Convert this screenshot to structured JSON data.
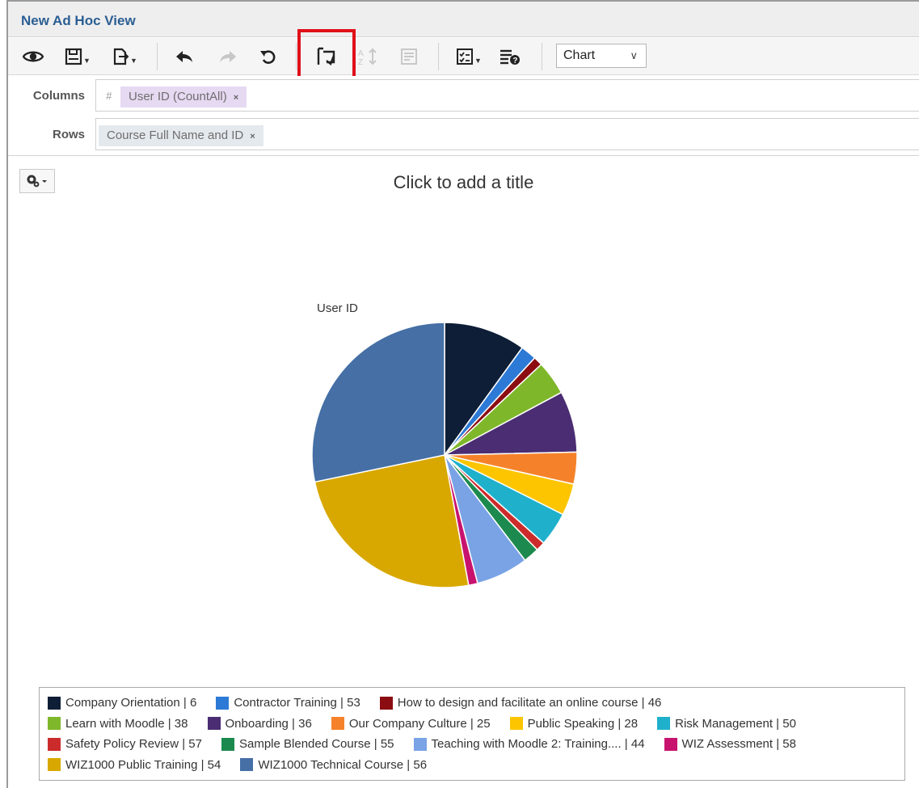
{
  "app": {
    "title": "New Ad Hoc View"
  },
  "toolbar": {
    "view_type": "Chart",
    "buttons": [
      {
        "name": "display-mode-button",
        "icon": "eye-icon"
      },
      {
        "name": "save-button",
        "icon": "save-icon"
      },
      {
        "name": "export-button",
        "icon": "export-icon"
      },
      {
        "name": "undo-button",
        "icon": "undo-icon"
      },
      {
        "name": "redo-button",
        "icon": "redo-icon"
      },
      {
        "name": "undo-all-button",
        "icon": "undo-all-icon"
      },
      {
        "name": "switch-groups-button",
        "icon": "switch-groups-icon"
      },
      {
        "name": "sort-button",
        "icon": "sort-icon"
      },
      {
        "name": "query-button",
        "icon": "sql-icon"
      },
      {
        "name": "input-controls-button",
        "icon": "input-controls-icon"
      },
      {
        "name": "data-format-button",
        "icon": "data-format-icon"
      }
    ]
  },
  "shelves": {
    "columns_label": "Columns",
    "rows_label": "Rows",
    "columns_prefix": "#",
    "columns_item": "User ID (CountAll)",
    "rows_item": "Course Full Name and ID",
    "remove_glyph": "×"
  },
  "chart": {
    "title_placeholder": "Click to add a title",
    "series_label": "User ID"
  },
  "chart_data": {
    "type": "pie",
    "title": "",
    "series_name": "User ID",
    "categories": [
      "Company Orientation | 6",
      "Contractor Training | 53",
      "How to design and facilitate an online course | 46",
      "Learn with Moodle | 38",
      "Onboarding | 36",
      "Our Company Culture | 25",
      "Public Speaking | 28",
      "Risk Management | 50",
      "Safety Policy Review | 57",
      "Sample Blended Course | 55",
      "Teaching with Moodle 2: Training.... | 44",
      "WIZ Assessment | 58",
      "WIZ1000 Public Training | 54",
      "WIZ1000 Technical Course | 56"
    ],
    "values": [
      36,
      7,
      4,
      15,
      27,
      14,
      14,
      15,
      4,
      7,
      23,
      4,
      89,
      102
    ],
    "colors": [
      "#0e1e36",
      "#2d7ad6",
      "#8b0d12",
      "#7fb72b",
      "#4a2d72",
      "#f5822a",
      "#fdc500",
      "#1fb0cc",
      "#cc2b2b",
      "#1c8a4e",
      "#7aa3e6",
      "#c8136e",
      "#d8a800",
      "#456fa5"
    ],
    "legend_position": "bottom",
    "legend_rows": [
      [
        0,
        1,
        2
      ],
      [
        3,
        4,
        5,
        6,
        7
      ],
      [
        8,
        9,
        10,
        11
      ],
      [
        12,
        13
      ]
    ]
  }
}
